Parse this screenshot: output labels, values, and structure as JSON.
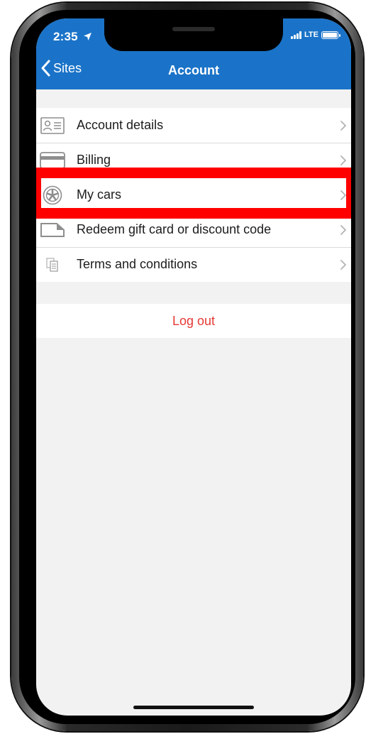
{
  "status_bar": {
    "time": "2:35",
    "network": "LTE"
  },
  "nav": {
    "back_label": "Sites",
    "title": "Account"
  },
  "menu": {
    "items": [
      {
        "label": "Account details",
        "icon": "id-card-icon"
      },
      {
        "label": "Billing",
        "icon": "credit-card-icon"
      },
      {
        "label": "My cars",
        "icon": "wheel-icon",
        "highlighted": true
      },
      {
        "label": "Redeem gift card or discount code",
        "icon": "gift-card-icon"
      },
      {
        "label": "Terms and conditions",
        "icon": "documents-icon"
      }
    ]
  },
  "logout": {
    "label": "Log out"
  },
  "colors": {
    "nav_bar": "#1a73c8",
    "logout_text": "#e53935",
    "highlight": "#ff0000",
    "screen_background": "#f2f2f2"
  }
}
